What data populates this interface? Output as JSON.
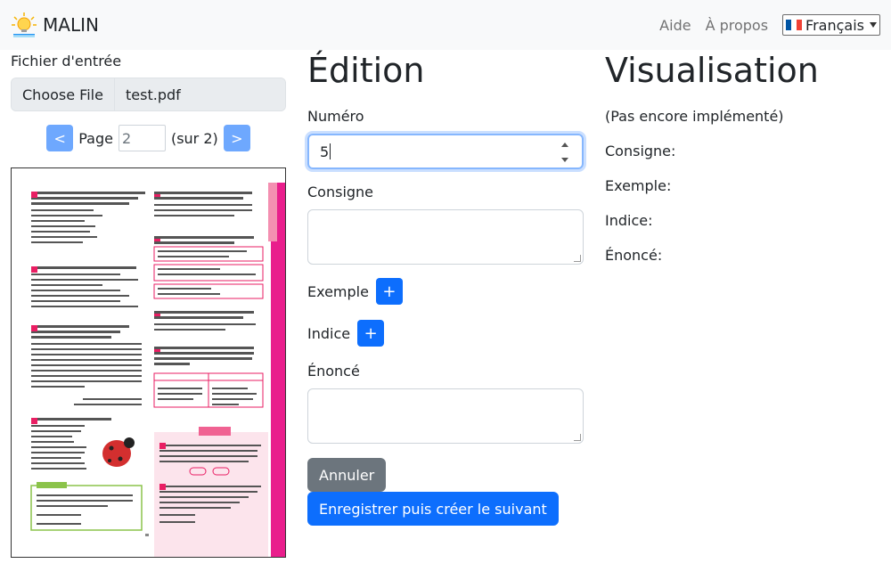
{
  "nav": {
    "brand": "MALIN",
    "links": [
      "Aide",
      "À propos"
    ],
    "language": "Français"
  },
  "input_panel": {
    "label": "Fichier d'entrée",
    "choose_file": "Choose File",
    "file_name": "test.pdf",
    "prev": "<",
    "next": ">",
    "page_label": "Page",
    "page_value": "2",
    "page_total": "(sur 2)"
  },
  "edition": {
    "title": "Édition",
    "numero_label": "Numéro",
    "numero_value": "5",
    "consigne_label": "Consigne",
    "exemple_label": "Exemple",
    "indice_label": "Indice",
    "enonce_label": "Énoncé",
    "add": "+",
    "cancel": "Annuler",
    "save": "Enregistrer puis créer le suivant"
  },
  "visualisation": {
    "title": "Visualisation",
    "note": "(Pas encore implémenté)",
    "fields": [
      "Consigne:",
      "Exemple:",
      "Indice:",
      "Énoncé:"
    ]
  },
  "colors": {
    "primary": "#0d6efd",
    "primary_light": "#6ea8fe",
    "secondary": "#6c757d",
    "pink": "#e91e8c"
  }
}
